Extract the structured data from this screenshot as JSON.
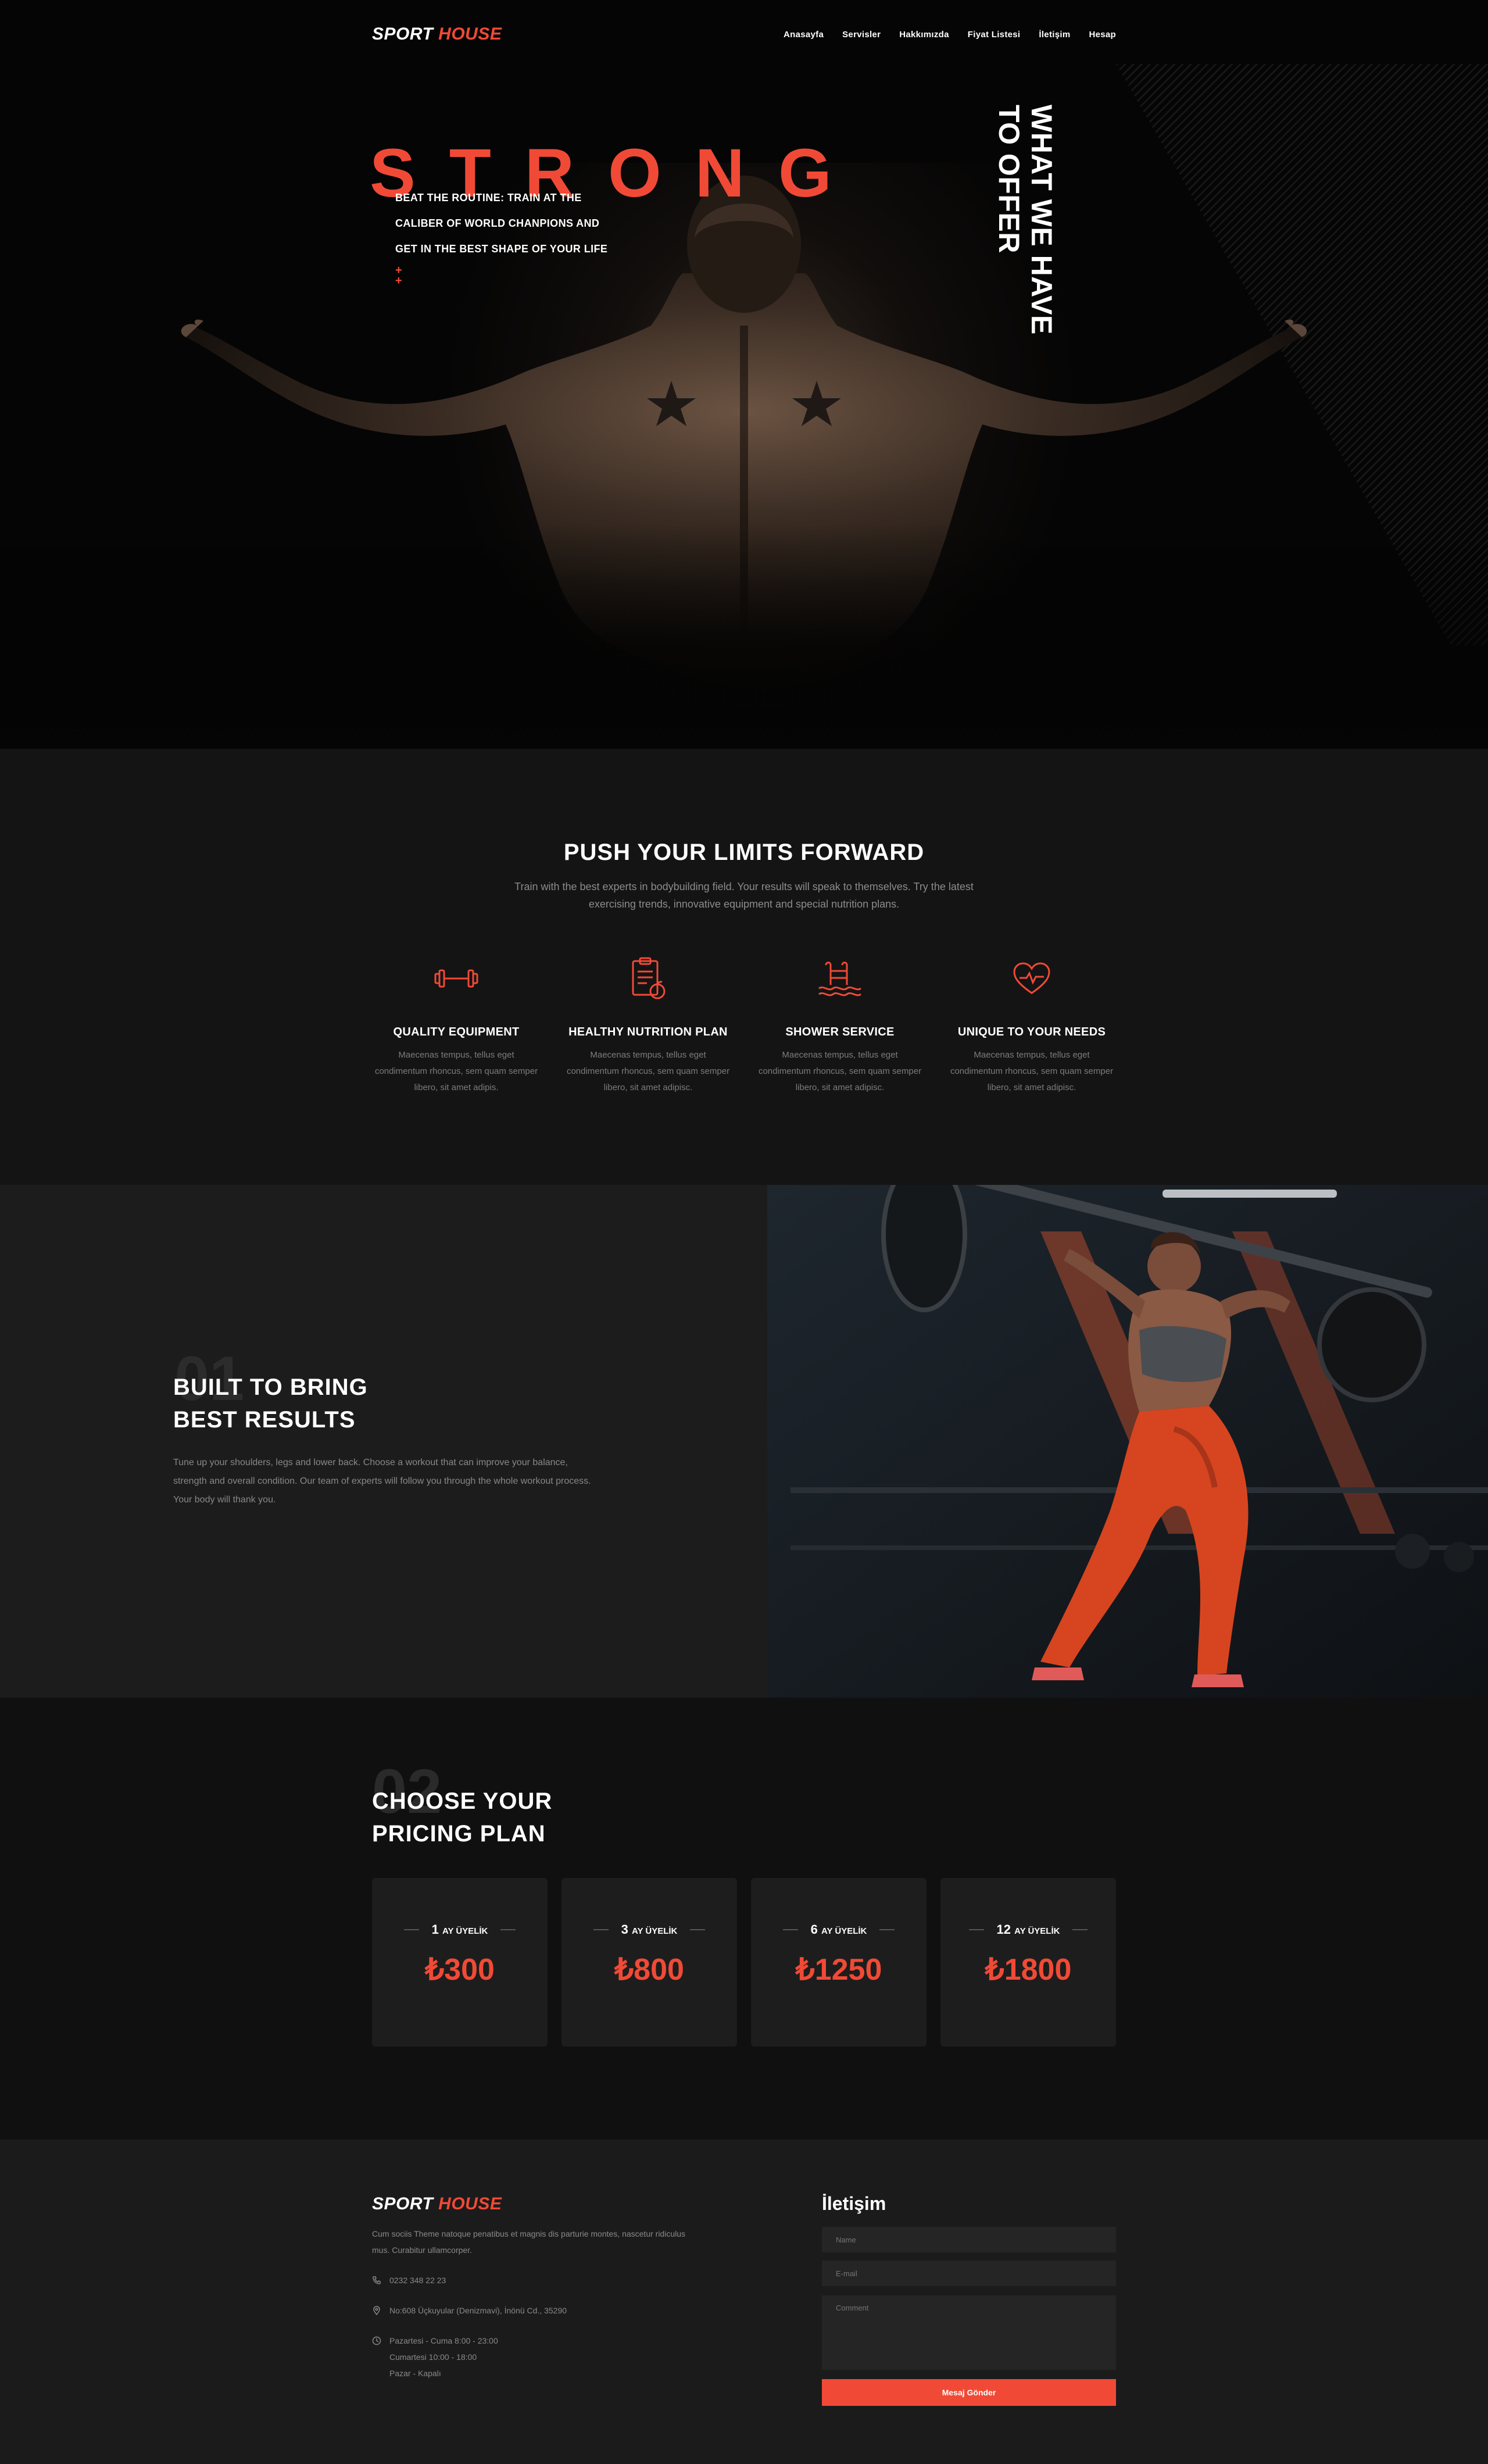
{
  "brand": {
    "part1": "SPORT",
    "part2": "HOUSE"
  },
  "nav": {
    "items": [
      {
        "label": "Anasayfa"
      },
      {
        "label": "Servisler"
      },
      {
        "label": "Hakkımızda"
      },
      {
        "label": "Fiyat Listesi"
      },
      {
        "label": "İletişim"
      },
      {
        "label": "Hesap"
      }
    ]
  },
  "hero": {
    "headline": "STRONG",
    "sub_line1": "BEAT THE ROUTINE: TRAIN AT THE",
    "sub_line2": "CALIBER OF WORLD CHANPIONS AND",
    "sub_line3": "GET IN THE BEST SHAPE OF YOUR LIFE",
    "plus1": "+",
    "plus2": "+",
    "vertical_line1": "WHAT WE HAVE",
    "vertical_line2": "TO OFFER"
  },
  "features": {
    "title": "PUSH YOUR LIMITS FORWARD",
    "intro": "Train with the best experts in bodybuilding field. Your results will speak to themselves. Try the latest exercising trends, innovative equipment and special nutrition plans.",
    "items": [
      {
        "icon": "dumbbell-icon",
        "title": "QUALITY EQUIPMENT",
        "text": "Maecenas tempus, tellus eget condimentum rhoncus, sem quam semper libero, sit amet adipis."
      },
      {
        "icon": "clipboard-apple-icon",
        "title": "HEALTHY NUTRITION PLAN",
        "text": "Maecenas tempus, tellus eget condimentum rhoncus, sem quam semper libero, sit amet adipisc."
      },
      {
        "icon": "pool-ladder-icon",
        "title": "SHOWER SERVICE",
        "text": "Maecenas tempus, tellus eget condimentum rhoncus, sem quam semper libero, sit amet adipisc."
      },
      {
        "icon": "heart-pulse-icon",
        "title": "UNIQUE TO YOUR NEEDS",
        "text": "Maecenas tempus, tellus eget condimentum rhoncus, sem quam semper libero, sit amet adipisc."
      }
    ]
  },
  "built": {
    "number": "01",
    "title_line1": "BUILT TO BRING",
    "title_line2": "BEST RESULTS",
    "text": "Tune up your shoulders, legs and lower back. Choose a workout that can improve your balance, strength and overall condition. Our team of experts will follow you through the whole workout process. Your body will thank you."
  },
  "pricing": {
    "number": "02",
    "title_line1": "CHOOSE YOUR",
    "title_line2": "PRICING PLAN",
    "plans": [
      {
        "months": "1",
        "unit": "AY ÜYELİK",
        "price": "₺300"
      },
      {
        "months": "3",
        "unit": "AY ÜYELİK",
        "price": "₺800"
      },
      {
        "months": "6",
        "unit": "AY ÜYELİK",
        "price": "₺1250"
      },
      {
        "months": "12",
        "unit": "AY ÜYELİK",
        "price": "₺1800"
      }
    ]
  },
  "footer": {
    "desc": "Cum sociis Theme natoque penatibus et magnis dis parturie montes, nascetur ridiculus mus. Curabitur ullamcorper.",
    "phone": "0232 348 22 23",
    "address": "No:608 Üçkuyular (Denizmavi), İnönü Cd., 35290",
    "hours_line1": "Pazartesi - Cuma 8:00 - 23:00",
    "hours_line2": "Cumartesi 10:00 - 18:00",
    "hours_line3": "Pazar - Kapalı",
    "contact_title": "İletişim",
    "name_placeholder": "Name",
    "email_placeholder": "E-mail",
    "comment_placeholder": "Comment",
    "send_label": "Mesaj Gönder"
  },
  "colors": {
    "accent": "#f04a36",
    "background": "#0a0a0a",
    "card": "#1d1d1d"
  }
}
